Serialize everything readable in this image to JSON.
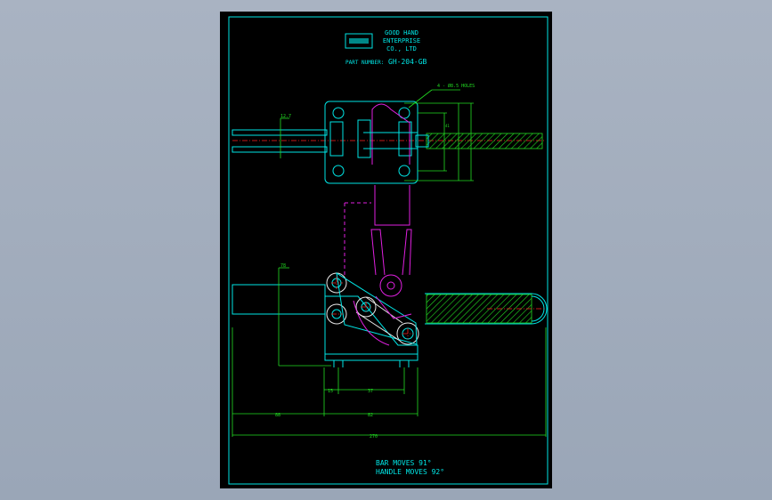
{
  "title_block": {
    "company_lines": [
      "GOOD HAND",
      "ENTERPRISE",
      "CO., LTD"
    ],
    "part_number_label": "PART NUMBER:",
    "part_number": "GH-204-GB"
  },
  "notes": {
    "bar_moves": "BAR MOVES 91°",
    "handle_moves": "HANDLE MOVES 92°"
  },
  "dimensions": {
    "holes_note": "4 - Ø8.5 HOLES",
    "d_top_left": "12.7",
    "d_left_height": "78",
    "d_15": "15",
    "d_37": "37",
    "d_88": "88",
    "d_82": "82",
    "d_270": "270",
    "d_side": "41"
  },
  "colors": {
    "outline": "#00e5e5",
    "dimension": "#22dd22",
    "mechanism": "#e020e0",
    "centerline": "#ff2020"
  }
}
